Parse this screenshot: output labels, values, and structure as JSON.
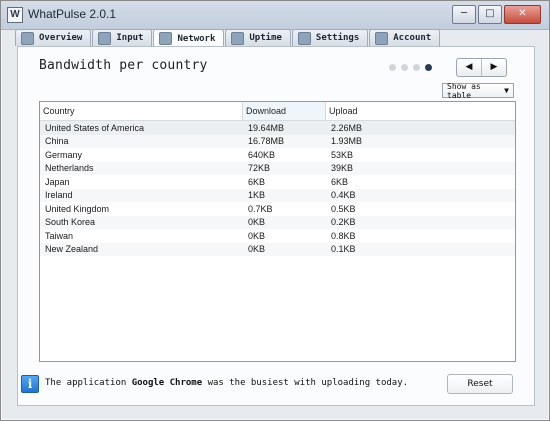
{
  "window": {
    "title": "WhatPulse 2.0.1",
    "icon_letter": "W"
  },
  "tabs": [
    {
      "label": "Overview",
      "icon": "home-icon"
    },
    {
      "label": "Input",
      "icon": "keyboard-icon"
    },
    {
      "label": "Network",
      "icon": "network-globe-icon"
    },
    {
      "label": "Uptime",
      "icon": "clock-icon"
    },
    {
      "label": "Settings",
      "icon": "settings-icon"
    },
    {
      "label": "Account",
      "icon": "account-icon"
    }
  ],
  "main": {
    "title": "Bandwidth per country",
    "view_mode": "Show as table",
    "table": {
      "columns": [
        "Country",
        "Download",
        "Upload"
      ],
      "rows": [
        [
          "United States of America",
          "19.64MB",
          "2.26MB"
        ],
        [
          "China",
          "16.78MB",
          "1.93MB"
        ],
        [
          "Germany",
          "640KB",
          "53KB"
        ],
        [
          "Netherlands",
          "72KB",
          "39KB"
        ],
        [
          "Japan",
          "6KB",
          "6KB"
        ],
        [
          "Ireland",
          "1KB",
          "0.4KB"
        ],
        [
          "United Kingdom",
          "0.7KB",
          "0.5KB"
        ],
        [
          "South Korea",
          "0KB",
          "0.2KB"
        ],
        [
          "Taiwan",
          "0KB",
          "0.8KB"
        ],
        [
          "New Zealand",
          "0KB",
          "0.1KB"
        ]
      ]
    }
  },
  "footer": {
    "message_prefix": "The application ",
    "app_name": "Google Chrome",
    "message_suffix": " was the busiest with uploading today.",
    "reset_label": "Reset"
  },
  "controls": {
    "prev_symbol": "◀",
    "next_symbol": "▶",
    "minimize_symbol": "─",
    "maximize_symbol": "□",
    "close_symbol": "✕",
    "dropdown_symbol": "▼"
  }
}
